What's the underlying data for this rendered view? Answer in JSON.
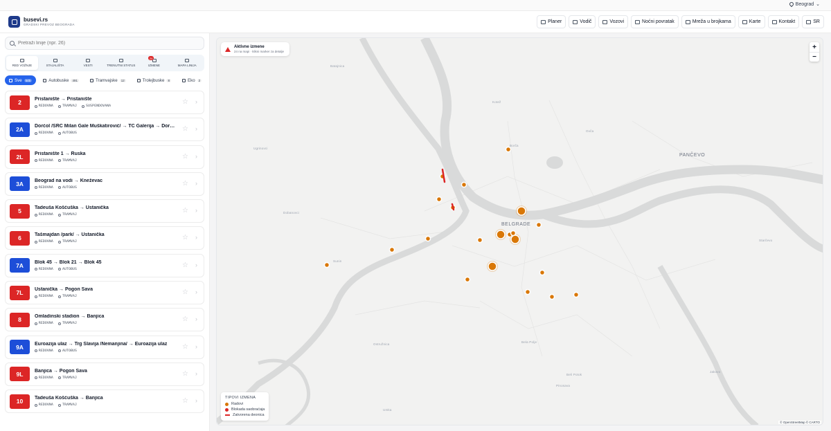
{
  "topbar": {
    "city": "Beograd"
  },
  "header": {
    "brand": "busevi.rs",
    "subtitle": "GRADSKI PREVOZ BEOGRADA",
    "nav": [
      {
        "label": "Planer",
        "icon": "route-icon"
      },
      {
        "label": "Vodič",
        "icon": "map-icon"
      },
      {
        "label": "Vozovi",
        "icon": "train-icon"
      },
      {
        "label": "Noćni povratak",
        "icon": "moon-icon"
      },
      {
        "label": "Mreža u brojkama",
        "icon": "chart-icon"
      },
      {
        "label": "Karte",
        "icon": "ticket-icon"
      },
      {
        "label": "Kontakt",
        "icon": "mail-icon"
      },
      {
        "label": "SR",
        "icon": "globe-icon"
      }
    ]
  },
  "sidebar": {
    "search_placeholder": "Pretraži linije (npr. 26)",
    "tabs": [
      {
        "label": "RED VOŽNJE",
        "active": true
      },
      {
        "label": "STAJALIŠTA"
      },
      {
        "label": "VESTI"
      },
      {
        "label": "TRENUTNI STATUS"
      },
      {
        "label": "IZMENE",
        "badge": "24"
      },
      {
        "label": "MAPA LINIJA"
      }
    ],
    "filters": [
      {
        "label": "Sve",
        "count": "545",
        "active": true
      },
      {
        "label": "Autobuske",
        "count": "491"
      },
      {
        "label": "Tramvajske",
        "count": "12"
      },
      {
        "label": "Trolejbuske",
        "count": "8"
      },
      {
        "label": "Eko",
        "count": "2"
      }
    ],
    "lines": [
      {
        "number": "2",
        "color": "#dc2626",
        "route": "Pristanište → Pristanište",
        "tags": [
          "REDOVNA",
          "TRAMVAJ",
          "SUSPENDOVANA"
        ]
      },
      {
        "number": "2A",
        "color": "#1d4ed8",
        "route": "Dorćol /SRC Milan Gale Muškatirović/ → TC Galerija → Dorćol /S…",
        "tags": [
          "REDOVNA",
          "AUTOBUS"
        ]
      },
      {
        "number": "2L",
        "color": "#dc2626",
        "route": "Pristanište 1 → Ruska",
        "tags": [
          "REDOVNA",
          "TRAMVAJ"
        ]
      },
      {
        "number": "3A",
        "color": "#1d4ed8",
        "route": "Beograd na vodi → Kneževac",
        "tags": [
          "REDOVNA",
          "AUTOBUS"
        ]
      },
      {
        "number": "5",
        "color": "#dc2626",
        "route": "Tadeuša Košćuška → Ustanička",
        "tags": [
          "REDOVNA",
          "TRAMVAJ"
        ]
      },
      {
        "number": "6",
        "color": "#dc2626",
        "route": "Tašmajdan /park/ → Ustanička",
        "tags": [
          "REDOVNA",
          "TRAMVAJ"
        ]
      },
      {
        "number": "7A",
        "color": "#1d4ed8",
        "route": "Blok 45 → Blok 21 → Blok 45",
        "tags": [
          "REDOVNA",
          "AUTOBUS"
        ]
      },
      {
        "number": "7L",
        "color": "#dc2626",
        "route": "Ustanička → Pogon Sava",
        "tags": [
          "REDOVNA",
          "TRAMVAJ"
        ]
      },
      {
        "number": "8",
        "color": "#dc2626",
        "route": "Omladinski stadion → Banjica",
        "tags": [
          "REDOVNA",
          "TRAMVAJ"
        ]
      },
      {
        "number": "9A",
        "color": "#1d4ed8",
        "route": "Euroazija ulaz → Trg Slavija /Nemanjina/ → Euroazija ulaz",
        "tags": [
          "REDOVNA",
          "AUTOBUS"
        ]
      },
      {
        "number": "9L",
        "color": "#dc2626",
        "route": "Banjica → Pogon Sava",
        "tags": [
          "REDOVNA",
          "TRAMVAJ"
        ]
      },
      {
        "number": "10",
        "color": "#dc2626",
        "route": "Tadeuša Košćuška → Banjica",
        "tags": [
          "REDOVNA",
          "TRAMVAJ"
        ]
      }
    ]
  },
  "map": {
    "alert_title": "Aktivne izmene",
    "alert_sub": "24 na mapi · klikni marker za detalje",
    "zoom_in": "+",
    "zoom_out": "−",
    "legend_title": "TIPOVI IZMENA",
    "legend": [
      {
        "label": "Radovi",
        "color": "#d97706",
        "kind": "dot"
      },
      {
        "label": "Blokada saobraćaja",
        "color": "#dc2626",
        "kind": "dot"
      },
      {
        "label": "Zatvorena deonica",
        "color": "#dc2626",
        "kind": "bar"
      }
    ],
    "attribution": "© OpenStreetMap © CARTO",
    "city_label": "BELGRADE",
    "place_labels": [
      "PANČEVO",
      "Borča",
      "Ovča",
      "Sunin",
      "Ostružnica",
      "Bela Polje",
      "Pinosava",
      "Umka",
      "Dobanovci",
      "Batajnica",
      "Starčevo",
      "Ugrinovci",
      "Beli Potok",
      "Kotež",
      "Jakovo"
    ],
    "accent": "#d97706"
  }
}
